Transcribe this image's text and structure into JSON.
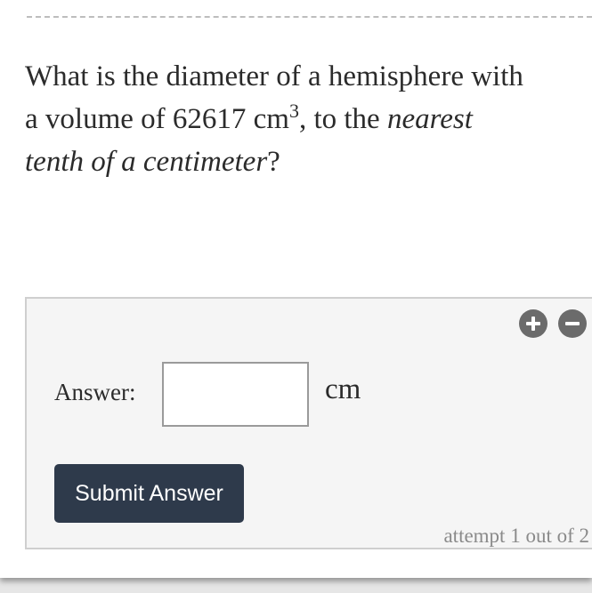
{
  "question": {
    "line1": "What is the diameter of a hemisphere with",
    "line2_prefix": "a volume of ",
    "volume_value": "62617",
    "volume_unit": "cm",
    "volume_exponent": "3",
    "line2_suffix": ", to the ",
    "emphasis_1": "nearest",
    "emphasis_2": "tenth of a centimeter",
    "end_mark": "?"
  },
  "answer_panel": {
    "zoom_in_icon": "plus-circle-icon",
    "zoom_out_icon": "minus-circle-icon",
    "answer_label": "Answer:",
    "answer_value": "",
    "unit": "cm",
    "submit_label": "Submit Answer",
    "attempt_text": "attempt 1 out of 2"
  },
  "colors": {
    "submit_background": "#2e3a4b",
    "zoom_button": "#6b6b6b",
    "panel_background": "#f5f5f5"
  }
}
